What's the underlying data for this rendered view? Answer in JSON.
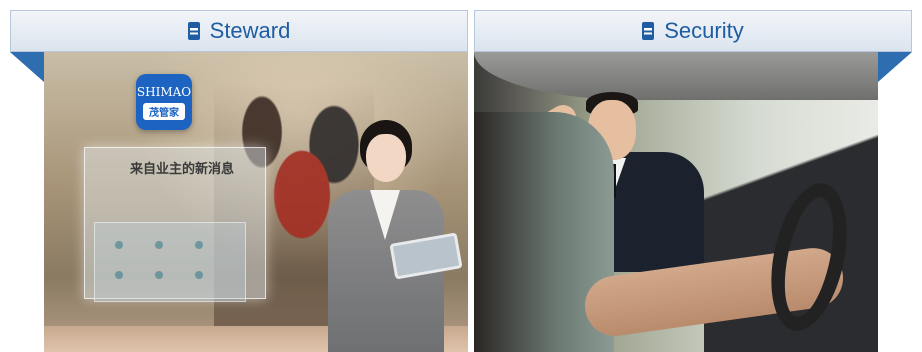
{
  "panels": [
    {
      "title": "Steward",
      "header_icon": "book-icon",
      "photo": {
        "app_brand": "SHIMAO",
        "app_name": "茂管家",
        "glass_text": "来自业主的新消息"
      }
    },
    {
      "title": "Security",
      "header_icon": "book-icon"
    }
  ],
  "colors": {
    "accent": "#2e6db0",
    "header_text": "#1f5da3",
    "header_bg_top": "#f2f5f9",
    "header_bg_bottom": "#dbe4ee"
  }
}
